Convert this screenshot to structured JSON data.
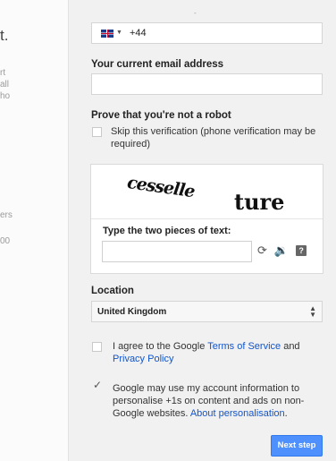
{
  "background_page": {
    "title_fragment": "t.",
    "text_fragments": [
      "rt",
      "all",
      "ho"
    ],
    "lower_fragments": [
      "ers",
      "00"
    ]
  },
  "phone": {
    "country_code": "+44",
    "flag_icon": "uk-flag-icon"
  },
  "email": {
    "label": "Your current email address",
    "value": ""
  },
  "robot": {
    "label": "Prove that you're not a robot",
    "skip_label_line1": "Skip this verification (phone verification may be",
    "skip_label_line2": "required)"
  },
  "captcha": {
    "word1": "cesselle",
    "word2": "ture",
    "prompt": "Type the two pieces of text:",
    "value": "",
    "icons": [
      "refresh-icon",
      "audio-icon",
      "help-icon"
    ]
  },
  "location": {
    "label": "Location",
    "selected": "United Kingdom"
  },
  "terms": {
    "prefix": "I agree to the Google ",
    "tos_link": "Terms of Service",
    "middle": " and",
    "privacy_link": "Privacy Policy"
  },
  "personalise": {
    "line1": "Google may use my account information to",
    "line2": "personalise +1s on content and ads on non-",
    "line3_prefix": "Google websites. ",
    "link": "About personalisation",
    "line3_suffix": "."
  },
  "next_button": {
    "label": "Next step"
  },
  "colors": {
    "link": "#1155cc",
    "button": "#4d90fe",
    "panel": "#f1f1f1"
  }
}
